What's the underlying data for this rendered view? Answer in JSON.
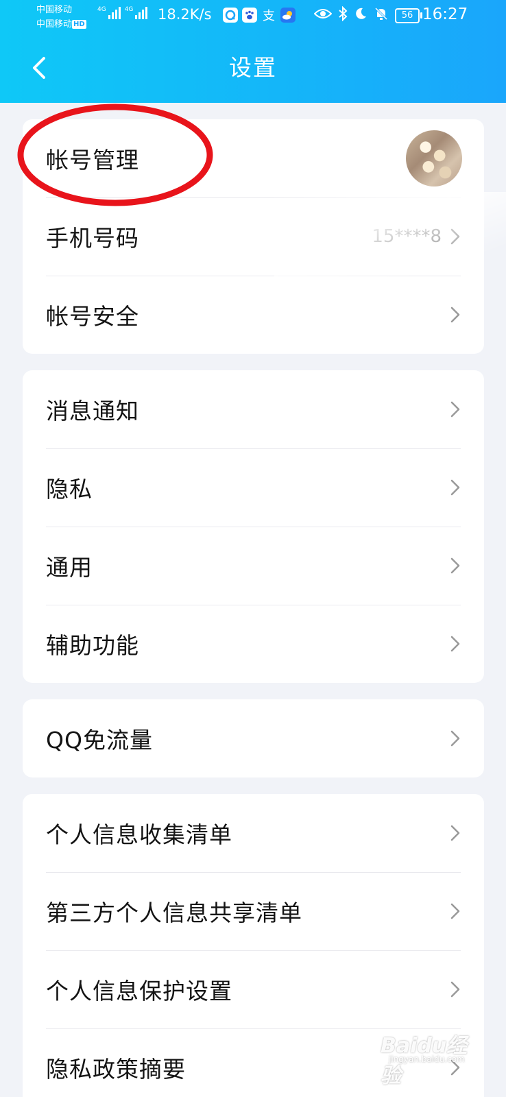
{
  "status_bar": {
    "carrier_1": "中国移动",
    "carrier_2": "中国移动",
    "hd_badge": "HD",
    "network_tag_1": "4G",
    "network_tag_2": "4G",
    "net_speed": "18.2K/s",
    "battery_level": "56",
    "time": "16:27",
    "icons": [
      "qq-browser-icon",
      "baidu-icon",
      "alipay-icon",
      "weather-icon",
      "eye-comfort-icon",
      "bluetooth-icon",
      "do-not-disturb-icon",
      "mute-icon"
    ]
  },
  "nav": {
    "title": "设置",
    "back_icon": "chevron-left-icon"
  },
  "groups": [
    {
      "items": [
        {
          "label": "帐号管理",
          "trailing": "avatar"
        },
        {
          "label": "手机号码",
          "value": "15****8"
        },
        {
          "label": "帐号安全"
        }
      ]
    },
    {
      "items": [
        {
          "label": "消息通知"
        },
        {
          "label": "隐私"
        },
        {
          "label": "通用"
        },
        {
          "label": "辅助功能"
        }
      ]
    },
    {
      "items": [
        {
          "label": "QQ免流量"
        }
      ]
    },
    {
      "items": [
        {
          "label": "个人信息收集清单"
        },
        {
          "label": "第三方个人信息共享清单"
        },
        {
          "label": "个人信息保护设置"
        },
        {
          "label": "隐私政策摘要"
        }
      ]
    }
  ],
  "watermark": {
    "main": "Baidu经验",
    "sub": "jingyan.baidu.com"
  },
  "colors": {
    "header_start": "#0fc8f7",
    "header_end": "#1aa6fb",
    "annotation": "#e8141b"
  }
}
